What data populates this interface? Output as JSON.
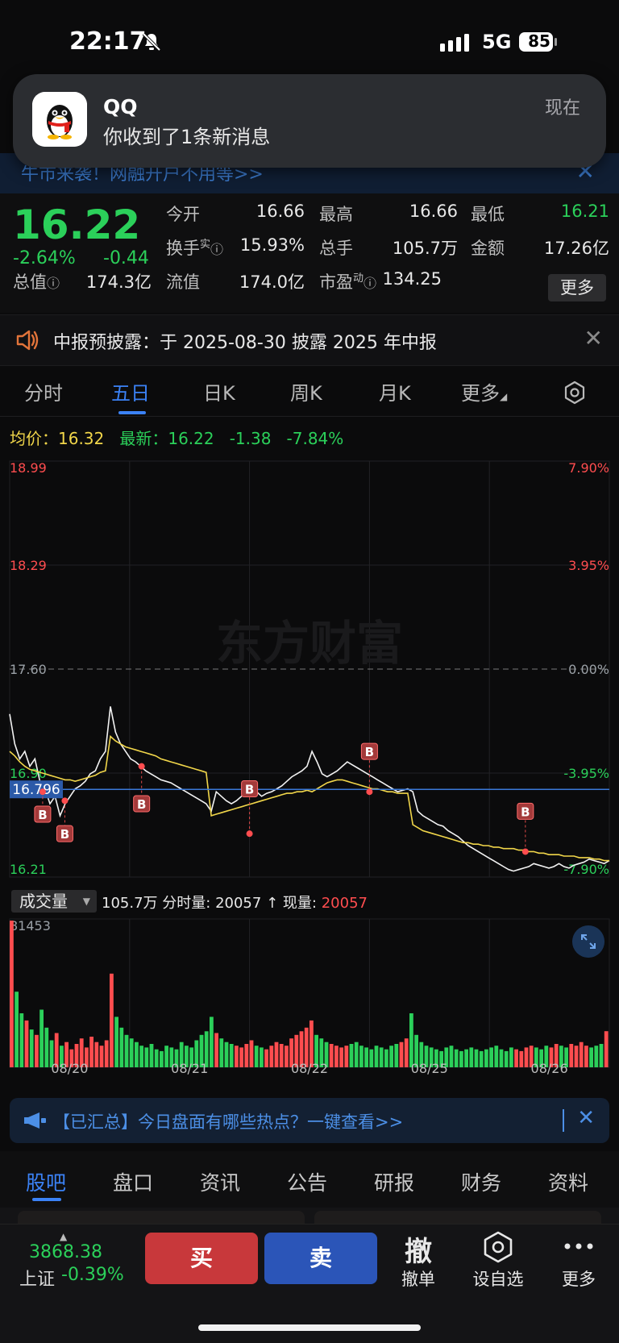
{
  "status_bar": {
    "time": "22:17",
    "network": "5G",
    "battery": "85"
  },
  "notification": {
    "app": "QQ",
    "message": "你收到了1条新消息",
    "time": "现在"
  },
  "banner": {
    "text": "牛市来袭！网融开户不用等>>",
    "close": "✕"
  },
  "quote": {
    "price": "16.22",
    "change_pct": "-2.64%",
    "change_abs": "-0.44",
    "rows": [
      [
        {
          "label": "今开",
          "value": "16.66"
        },
        {
          "label": "最高",
          "value": "16.66"
        },
        {
          "label": "最低",
          "value": "16.21"
        }
      ],
      [
        {
          "label": "换手",
          "value": "15.93%"
        },
        {
          "label": "总手",
          "value": "105.7万"
        },
        {
          "label": "金额",
          "value": "17.26亿"
        }
      ],
      [
        {
          "label": "总值",
          "value": "174.3亿"
        },
        {
          "label": "流值",
          "value": "174.0亿"
        },
        {
          "label": "市盈",
          "value": "134.25"
        }
      ]
    ],
    "turnover_sup": "实",
    "pe_sup": "动",
    "more": "更多"
  },
  "announcement": {
    "text": "中报预披露：于 2025-08-30 披露 2025 年中报",
    "close": "✕"
  },
  "tabs": [
    "分时",
    "五日",
    "日K",
    "周K",
    "月K",
    "更多"
  ],
  "active_tab": 1,
  "infoline": {
    "avg_label": "均价：",
    "avg_value": "16.32",
    "latest_label": "最新：",
    "latest_price": "16.22",
    "latest_chg": "-1.38",
    "latest_pct": "-7.84%"
  },
  "chart_data": {
    "type": "line",
    "title": "",
    "watermark": "东方财富",
    "x_days": [
      "08/20",
      "08/21",
      "08/22",
      "08/25",
      "08/26"
    ],
    "y_labels_left": [
      "18.99",
      "18.29",
      "17.60",
      "16.90",
      "16.21"
    ],
    "y_labels_right": [
      "7.90%",
      "3.95%",
      "0.00%",
      "-3.95%",
      "-7.90%"
    ],
    "ylim": [
      16.21,
      18.99
    ],
    "prev_close": 17.6,
    "crosshair_price": "16.796",
    "series": [
      {
        "name": "",
        "values": [
          17.3,
          17.1,
          17.0,
          17.05,
          16.95,
          17.0,
          16.85,
          16.8,
          16.7,
          16.75,
          16.62,
          16.7,
          16.75,
          16.8,
          16.82,
          16.85,
          16.9,
          16.92,
          17.0,
          17.05,
          17.35,
          17.18,
          17.1,
          17.05,
          17.0,
          16.98,
          16.95,
          16.92,
          16.9,
          16.88,
          16.86,
          16.85,
          16.84,
          16.82,
          16.8,
          16.78,
          16.76,
          16.74,
          16.72,
          16.7,
          16.65,
          16.78,
          16.75,
          16.72,
          16.7,
          16.72,
          16.75,
          16.78,
          16.8,
          16.78,
          16.75,
          16.77,
          16.78,
          16.8,
          16.82,
          16.85,
          16.88,
          16.9,
          16.92,
          16.95,
          17.05,
          16.98,
          16.9,
          16.88,
          16.9,
          16.92,
          16.95,
          16.98,
          16.96,
          16.94,
          16.92,
          16.9,
          16.88,
          16.86,
          16.84,
          16.82,
          16.8,
          16.78,
          16.79,
          16.8,
          16.78,
          16.65,
          16.62,
          16.6,
          16.58,
          16.56,
          16.55,
          16.52,
          16.5,
          16.48,
          16.45,
          16.42,
          16.4,
          16.38,
          16.36,
          16.34,
          16.32,
          16.3,
          16.28,
          16.26,
          16.25,
          16.26,
          16.27,
          16.28,
          16.3,
          16.29,
          16.28,
          16.27,
          16.28,
          16.3,
          16.28,
          16.27,
          16.29,
          16.3,
          16.31,
          16.33,
          16.32,
          16.31,
          16.3,
          16.32
        ]
      },
      {
        "name": "",
        "values": [
          17.05,
          17.02,
          16.98,
          16.95,
          16.93,
          16.92,
          16.91,
          16.9,
          16.89,
          16.88,
          16.87,
          16.86,
          16.86,
          16.85,
          16.86,
          16.87,
          16.88,
          16.89,
          16.91,
          16.92,
          17.15,
          17.12,
          17.1,
          17.08,
          17.07,
          17.06,
          17.05,
          17.04,
          17.03,
          17.02,
          17.0,
          16.99,
          16.98,
          16.97,
          16.96,
          16.95,
          16.94,
          16.93,
          16.92,
          16.91,
          16.62,
          16.63,
          16.64,
          16.65,
          16.66,
          16.67,
          16.68,
          16.69,
          16.7,
          16.71,
          16.72,
          16.73,
          16.74,
          16.75,
          16.76,
          16.77,
          16.77,
          16.78,
          16.78,
          16.79,
          16.78,
          16.8,
          16.82,
          16.84,
          16.85,
          16.86,
          16.86,
          16.85,
          16.84,
          16.83,
          16.82,
          16.81,
          16.8,
          16.8,
          16.79,
          16.78,
          16.78,
          16.77,
          16.77,
          16.77,
          16.56,
          16.54,
          16.52,
          16.51,
          16.5,
          16.49,
          16.48,
          16.47,
          16.46,
          16.45,
          16.44,
          16.44,
          16.43,
          16.43,
          16.42,
          16.42,
          16.41,
          16.41,
          16.4,
          16.4,
          16.4,
          16.39,
          16.39,
          16.38,
          16.38,
          16.37,
          16.37,
          16.36,
          16.36,
          16.36,
          16.35,
          16.35,
          16.35,
          16.34,
          16.34,
          16.34,
          16.33,
          16.33,
          16.32,
          16.32
        ]
      }
    ],
    "volume": {
      "label": "成交量",
      "ymax": "81453",
      "total": "105.7万",
      "tick_label": "分时量:",
      "tick_value": "20057",
      "now_label": "现量:",
      "now_value": "20057",
      "values": [
        81453,
        42000,
        30000,
        26000,
        21000,
        18000,
        32000,
        22000,
        15000,
        19000,
        12000,
        14000,
        10000,
        13000,
        16000,
        11000,
        17000,
        14000,
        12000,
        15000,
        52000,
        28000,
        22000,
        18000,
        16000,
        14000,
        12000,
        11000,
        13000,
        10000,
        9000,
        12000,
        11000,
        10000,
        14000,
        12000,
        11000,
        15000,
        18000,
        20000,
        28000,
        19000,
        16000,
        14000,
        13000,
        12000,
        11000,
        13000,
        15000,
        12000,
        11000,
        10000,
        12000,
        14000,
        13000,
        12000,
        16000,
        18000,
        20000,
        22000,
        26000,
        18000,
        16000,
        14000,
        13000,
        12000,
        11000,
        12000,
        13000,
        14000,
        12000,
        11000,
        10000,
        12000,
        11000,
        10000,
        12000,
        13000,
        14000,
        16000,
        30000,
        18000,
        14000,
        12000,
        11000,
        10000,
        9000,
        11000,
        12000,
        10000,
        9000,
        10000,
        11000,
        10000,
        9000,
        10000,
        11000,
        12000,
        10000,
        9000,
        11000,
        10000,
        9000,
        11000,
        12000,
        11000,
        10000,
        12000,
        11000,
        13000,
        12000,
        11000,
        13000,
        12000,
        14000,
        12000,
        11000,
        12000,
        13000,
        20057
      ]
    }
  },
  "trade_markers": [
    {
      "label": "B"
    },
    {
      "label": "B"
    },
    {
      "label": "B"
    },
    {
      "label": "B"
    },
    {
      "label": "B"
    },
    {
      "label": "B"
    }
  ],
  "promo": {
    "text": "【已汇总】今日盘面有哪些热点？一键查看>>",
    "close": "✕"
  },
  "subtabs": [
    "股吧",
    "盘口",
    "资讯",
    "公告",
    "研报",
    "财务",
    "资料"
  ],
  "active_subtab": 0,
  "bottom_bar": {
    "index_value": "3868.38",
    "index_name": "上证",
    "index_change": "-0.39%",
    "buy": "买",
    "sell": "卖",
    "cancel_icon": "撤",
    "cancel_label": "撤单",
    "watch_label": "设自选",
    "more_label": "更多"
  },
  "colors": {
    "up": "#ff4d4f",
    "down": "#2bd05a",
    "avg": "#f1d64a",
    "accent": "#3b82f6"
  }
}
